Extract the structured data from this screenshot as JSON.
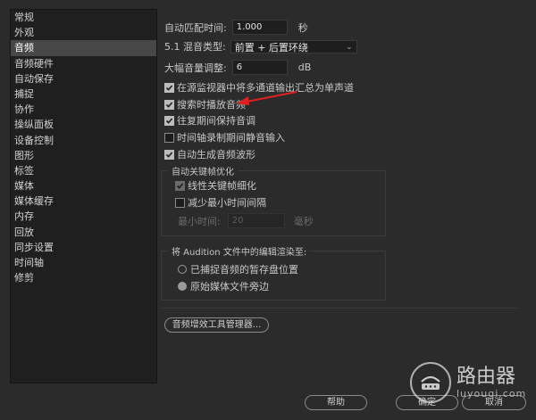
{
  "sidebar": {
    "items": [
      {
        "label": "常规",
        "active": false
      },
      {
        "label": "外观",
        "active": false
      },
      {
        "label": "音频",
        "active": true
      },
      {
        "label": "音频硬件",
        "active": false
      },
      {
        "label": "自动保存",
        "active": false
      },
      {
        "label": "捕捉",
        "active": false
      },
      {
        "label": "协作",
        "active": false
      },
      {
        "label": "操纵面板",
        "active": false
      },
      {
        "label": "设备控制",
        "active": false
      },
      {
        "label": "图形",
        "active": false
      },
      {
        "label": "标签",
        "active": false
      },
      {
        "label": "媒体",
        "active": false
      },
      {
        "label": "媒体缓存",
        "active": false
      },
      {
        "label": "内存",
        "active": false
      },
      {
        "label": "回放",
        "active": false
      },
      {
        "label": "同步设置",
        "active": false
      },
      {
        "label": "时间轴",
        "active": false
      },
      {
        "label": "修剪",
        "active": false
      }
    ]
  },
  "settings": {
    "auto_match_label": "自动匹配时间:",
    "auto_match_value": "1.000",
    "auto_match_unit": "秒",
    "mix_type_label": "5.1 混音类型:",
    "mix_type_value": "前置 + 后置环绕",
    "gain_label": "大幅音量调整:",
    "gain_value": "6",
    "gain_unit": "dB",
    "checkboxes": [
      {
        "label": "在源监视器中将多通道输出汇总为单声道",
        "checked": true
      },
      {
        "label": "搜索时播放音频",
        "checked": true
      },
      {
        "label": "往复期间保持音调",
        "checked": true
      },
      {
        "label": "时间轴录制期间静音输入",
        "checked": false
      },
      {
        "label": "自动生成音频波形",
        "checked": true
      }
    ],
    "keyframe_group": {
      "title": "自动关键帧优化",
      "linear_label": "线性关键帧细化",
      "linear_checked": true,
      "min_interval_label": "减少最小时间间隔",
      "min_interval_checked": false,
      "min_time_label": "最小时间:",
      "min_time_value": "20",
      "min_time_unit": "毫秒"
    },
    "audition_group": {
      "title": "将 Audition 文件中的编辑渲染至:",
      "options": [
        {
          "label": "已捕捉音频的暂存盘位置",
          "selected": false
        },
        {
          "label": "原始媒体文件旁边",
          "selected": true
        }
      ]
    },
    "plugin_manager_label": "音频增效工具管理器..."
  },
  "footer": {
    "help_label": "帮助",
    "ok_label": "确定",
    "cancel_label": "取消"
  },
  "watermark": {
    "title": "路由器",
    "subtitle": "luyouqi.com"
  },
  "colors": {
    "annotation_arrow": "#e02020"
  }
}
